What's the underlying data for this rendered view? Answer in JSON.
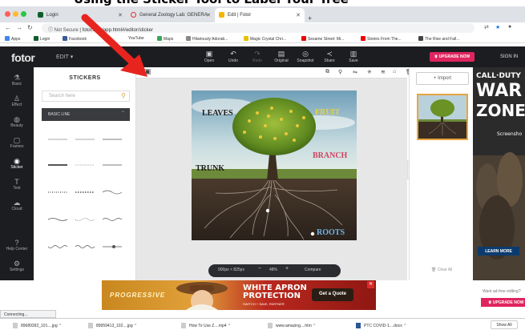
{
  "caption": "Using the Sticker Tool to Label Your Tree",
  "browser": {
    "tabs": [
      {
        "label": "Login"
      },
      {
        "label": "General Zoology Lab: GENERA"
      },
      {
        "label": "Edit | Fotor"
      }
    ],
    "address_security": "Not Secure",
    "url": "fotor.com/app.html#/editor/sticker",
    "bookmarks": [
      "Apps",
      "Login",
      "Facebook",
      "YouTube",
      "Maps",
      "Hilariously Adorab...",
      "Magic Crystal Chri...",
      "Sesame Street: Mi...",
      "Stories From The...",
      "The Rise and Fall..."
    ]
  },
  "fotor": {
    "logo": "fotor",
    "edit_menu": "EDIT ▾",
    "tools": [
      {
        "icon": "open-icon",
        "label": "Open"
      },
      {
        "icon": "undo-icon",
        "label": "Undo"
      },
      {
        "icon": "redo-icon",
        "label": "Redo"
      },
      {
        "icon": "original-icon",
        "label": "Original"
      },
      {
        "icon": "snapshot-icon",
        "label": "Snapshot"
      },
      {
        "icon": "share-icon",
        "label": "Share"
      },
      {
        "icon": "save-icon",
        "label": "Save"
      }
    ],
    "upgrade": "UPGRADE NOW",
    "sign_in": "SIGN IN"
  },
  "rail": [
    {
      "label": "Basic"
    },
    {
      "label": "Effect"
    },
    {
      "label": "Beauty"
    },
    {
      "label": "Frames"
    },
    {
      "label": "Sticker"
    },
    {
      "label": "Text"
    },
    {
      "label": "Cloud"
    },
    {
      "label": "Help Center"
    },
    {
      "label": "Settings"
    }
  ],
  "stickers_panel": {
    "title": "STICKERS",
    "search_placeholder": "Search here",
    "category": "BASIC LINE"
  },
  "canvas": {
    "labels": {
      "leaves": "LEAVES",
      "fruit": "FRUIT",
      "branch": "BRANCH",
      "trunk": "TRUNK",
      "roots": "ROOTS"
    },
    "label_colors": {
      "leaves": "#1a1a1a",
      "fruit": "#e9d23a",
      "branch": "#d0435f",
      "trunk": "#1a1a1a",
      "roots": "#6fb4e8"
    },
    "zoom": {
      "size": "900px × 825px",
      "minus": "−",
      "percent": "48%",
      "plus": "+",
      "compare": "Compare"
    }
  },
  "right_panel": {
    "import": "+ Import",
    "clear_all": "Clear All"
  },
  "side_ad": {
    "lines": [
      "CALL·DUTY",
      "WAR",
      "ZONE"
    ],
    "screenshot": "Screensho",
    "learn_more": "LEARN MORE"
  },
  "bottom_ad": {
    "brand": "PROGRESSIVE",
    "headline_1": "WHITE APRON",
    "headline_2": "PROTECTION",
    "sub": "SWITCH + SAVE, PARTNER",
    "cta": "Get a Quote"
  },
  "ad_free": {
    "text": "Want ad-free editing?",
    "button": "UPGRADE NOW"
  },
  "status": "Connecting...",
  "downloads": [
    "89689392_101....jpg",
    "89959413_102....jpg",
    "How To Use Z....mp4",
    "www.amazing....htm",
    "PTC COVID-1....docx"
  ],
  "show_all": "Show All",
  "colors": {
    "fotor_dark": "#1c1d21",
    "accent_pink": "#e0245e",
    "annotation_red": "#e8241e"
  }
}
